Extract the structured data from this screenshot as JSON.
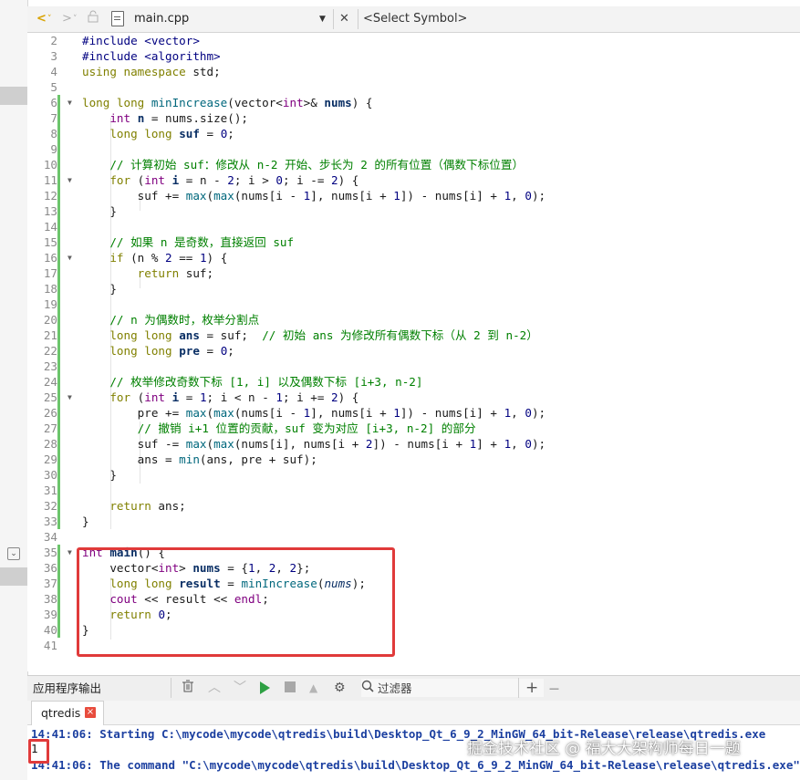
{
  "toolbar": {
    "back": "<",
    "back_dropdown": "˅",
    "forward": ">",
    "forward_dropdown": "˅",
    "filename": "main.cpp",
    "file_dropdown": "▼",
    "close": "✕",
    "symbol_placeholder": "<Select Symbol>"
  },
  "editor": {
    "lines": [
      {
        "n": "2"
      },
      {
        "n": "3"
      },
      {
        "n": "4"
      },
      {
        "n": "5"
      },
      {
        "n": "6"
      },
      {
        "n": "7"
      },
      {
        "n": "8"
      },
      {
        "n": "9"
      },
      {
        "n": "10"
      },
      {
        "n": "11"
      },
      {
        "n": "12"
      },
      {
        "n": "13"
      },
      {
        "n": "14"
      },
      {
        "n": "15"
      },
      {
        "n": "16"
      },
      {
        "n": "17"
      },
      {
        "n": "18"
      },
      {
        "n": "19"
      },
      {
        "n": "20"
      },
      {
        "n": "21"
      },
      {
        "n": "22"
      },
      {
        "n": "23"
      },
      {
        "n": "24"
      },
      {
        "n": "25"
      },
      {
        "n": "26"
      },
      {
        "n": "27"
      },
      {
        "n": "28"
      },
      {
        "n": "29"
      },
      {
        "n": "30"
      },
      {
        "n": "31"
      },
      {
        "n": "32"
      },
      {
        "n": "33"
      },
      {
        "n": "34"
      },
      {
        "n": "35"
      },
      {
        "n": "36"
      },
      {
        "n": "37"
      },
      {
        "n": "38"
      },
      {
        "n": "39"
      },
      {
        "n": "40"
      },
      {
        "n": "41"
      }
    ],
    "code": {
      "l2": "#include <vector>",
      "l3": "#include <algorithm>",
      "l4a": "using namespace",
      "l4b": " std;",
      "l6": [
        "long long ",
        "minIncrease",
        "(vector<",
        "int",
        ">& ",
        "nums",
        ") {"
      ],
      "l7": [
        "    ",
        "int",
        " ",
        "n",
        " = nums.size();"
      ],
      "l8": [
        "    ",
        "long long",
        " ",
        "suf",
        " = ",
        "0",
        ";"
      ],
      "l10": "    // 计算初始 suf：修改从 n-2 开始、步长为 2 的所有位置（偶数下标位置）",
      "l11": [
        "    ",
        "for",
        " (",
        "int",
        " ",
        "i",
        " = n - ",
        "2",
        "; i > ",
        "0",
        "; i -= ",
        "2",
        ") {"
      ],
      "l12": [
        "        suf += ",
        "max",
        "(",
        "max",
        "(nums[i - ",
        "1",
        "], nums[i + ",
        "1",
        "]) - nums[i] + ",
        "1",
        ", ",
        "0",
        ");"
      ],
      "l13": "    }",
      "l15": "    // 如果 n 是奇数，直接返回 suf",
      "l16": [
        "    ",
        "if",
        " (n % ",
        "2",
        " == ",
        "1",
        ") {"
      ],
      "l17": [
        "        ",
        "return",
        " suf;"
      ],
      "l18": "    }",
      "l20": "    // n 为偶数时，枚举分割点",
      "l21": [
        "    ",
        "long long",
        " ",
        "ans",
        " = suf;  ",
        "// 初始 ans 为修改所有偶数下标（从 2 到 n-2）"
      ],
      "l22": [
        "    ",
        "long long",
        " ",
        "pre",
        " = ",
        "0",
        ";"
      ],
      "l24": "    // 枚举修改奇数下标 [1, i] 以及偶数下标 [i+3, n-2]",
      "l25": [
        "    ",
        "for",
        " (",
        "int",
        " ",
        "i",
        " = ",
        "1",
        "; i < n - ",
        "1",
        "; i += ",
        "2",
        ") {"
      ],
      "l26": [
        "        pre += ",
        "max",
        "(",
        "max",
        "(nums[i - ",
        "1",
        "], nums[i + ",
        "1",
        "]) - nums[i] + ",
        "1",
        ", ",
        "0",
        ");"
      ],
      "l27": "        // 撤销 i+1 位置的贡献，suf 变为对应 [i+3, n-2] 的部分",
      "l28": [
        "        suf -= ",
        "max",
        "(",
        "max",
        "(nums[i], nums[i + ",
        "2",
        "]) - nums[i + ",
        "1",
        "] + ",
        "1",
        ", ",
        "0",
        ");"
      ],
      "l29": [
        "        ans = ",
        "min",
        "(ans, pre + suf);"
      ],
      "l30": "    }",
      "l32": [
        "    ",
        "return",
        " ans;"
      ],
      "l33": "}",
      "l35": [
        "int",
        " ",
        "main",
        "() {"
      ],
      "l36": [
        "    vector<",
        "int",
        "> ",
        "nums",
        " = {",
        "1",
        ", ",
        "2",
        ", ",
        "2",
        "};"
      ],
      "l37": [
        "    ",
        "long long",
        " ",
        "result",
        " = ",
        "minIncrease",
        "(",
        "nums",
        ");"
      ],
      "l38": [
        "    ",
        "cout",
        " << result << ",
        "endl",
        ";"
      ],
      "l39": [
        "    ",
        "return",
        " ",
        "0",
        ";"
      ],
      "l40": "}"
    }
  },
  "output_pane": {
    "title": "应用程序输出",
    "filter_label": "过滤器",
    "add": "+",
    "remove": "—",
    "tab_label": "qtredis",
    "tab_close": "×",
    "line1": "14:41:06: Starting C:\\mycode\\mycode\\qtredis\\build\\Desktop_Qt_6_9_2_MinGW_64_bit-Release\\release\\qtredis.exe",
    "result": "1",
    "line3": "14:41:06: The command \"C:\\mycode\\mycode\\qtredis\\build\\Desktop_Qt_6_9_2_MinGW_64_bit-Release\\release\\qtredis.exe\""
  },
  "watermark": "掘金技术社区 @ 福大大架构师每日一题",
  "colors": {
    "keyword": "#808000",
    "type": "#800080",
    "comment": "#008000",
    "number": "#000080",
    "function": "#00677c",
    "highlight_box": "#e03a3a",
    "output_text": "#1b3fa0",
    "run_button": "#2ea043"
  },
  "icons": [
    "back-arrow-icon",
    "forward-arrow-icon",
    "lock-icon",
    "file-icon",
    "close-icon",
    "clear-output-icon",
    "chevron-up-icon",
    "chevron-down-icon",
    "run-icon",
    "stop-icon",
    "attach-debugger-icon",
    "settings-gear-icon",
    "search-icon"
  ]
}
